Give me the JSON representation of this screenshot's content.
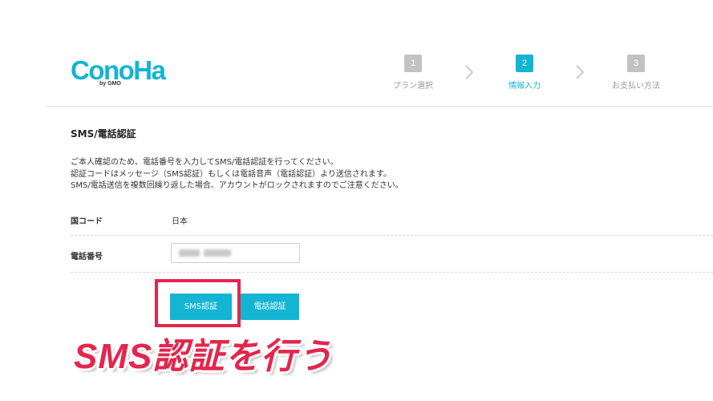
{
  "brand": {
    "logo_text": "ConoHa",
    "logo_sub": "by GMO",
    "accent": "#14b4d3"
  },
  "steps": [
    {
      "num": "1",
      "label": "プラン選択",
      "state": "done"
    },
    {
      "num": "2",
      "label": "情報入力",
      "state": "active"
    },
    {
      "num": "3",
      "label": "お支払い方法",
      "state": "todo"
    }
  ],
  "section": {
    "title": "SMS/電話認証",
    "desc": [
      "ご本人確認のため、電話番号を入力してSMS/電話認証を行ってください。",
      "認証コードはメッセージ（SMS認証）もしくは電話音声（電話認証）より送信されます。",
      "SMS/電話送信を複数回繰り返した場合、アカウントがロックされますのでご注意ください。"
    ]
  },
  "form": {
    "country_label": "国コード",
    "country_value": "日本",
    "phone_label": "電話番号"
  },
  "buttons": {
    "sms": "SMS認証",
    "phone": "電話認証"
  },
  "annotation": {
    "text": "SMS認証を行う",
    "color": "#e3264d"
  }
}
